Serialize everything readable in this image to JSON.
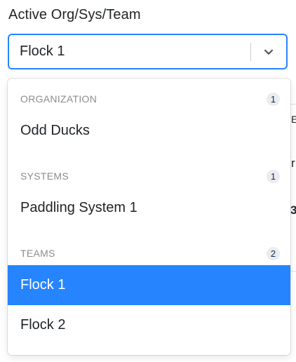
{
  "field": {
    "label": "Active Org/Sys/Team",
    "selected_value": "Flock 1",
    "accent_color": "#2684ff"
  },
  "background_fragments": [
    "E",
    "r",
    "3"
  ],
  "menu": {
    "groups": [
      {
        "title": "ORGANIZATION",
        "count": "1",
        "options": [
          {
            "label": "Odd Ducks",
            "selected": false
          }
        ]
      },
      {
        "title": "SYSTEMS",
        "count": "1",
        "options": [
          {
            "label": "Paddling System 1",
            "selected": false
          }
        ]
      },
      {
        "title": "TEAMS",
        "count": "2",
        "options": [
          {
            "label": "Flock 1",
            "selected": true
          },
          {
            "label": "Flock 2",
            "selected": false
          }
        ]
      }
    ]
  }
}
